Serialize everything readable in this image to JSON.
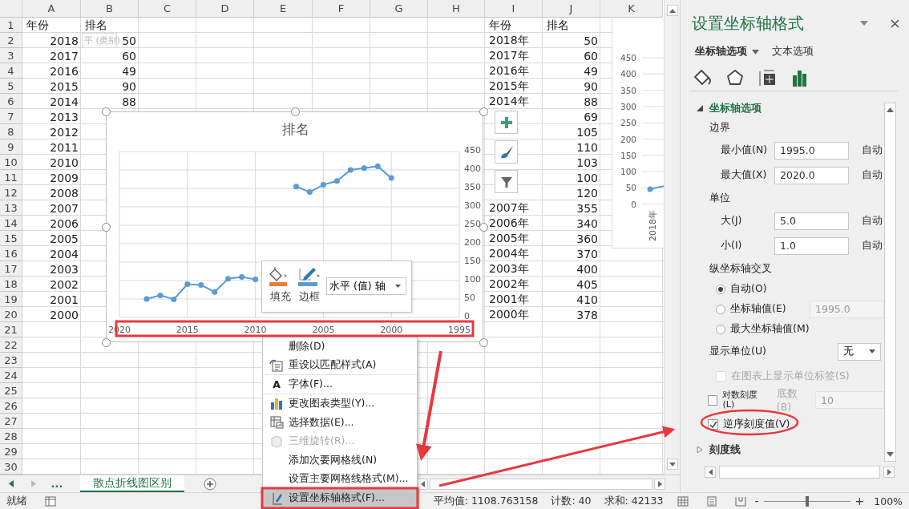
{
  "sheet": {
    "columns": [
      "A",
      "B",
      "C",
      "D",
      "E",
      "F",
      "G",
      "H",
      "I",
      "J",
      "K"
    ],
    "rows": [
      {
        "num": "1",
        "cells": {
          "A": {
            "text": "年份",
            "kind": "text"
          },
          "B": {
            "text": "排名",
            "kind": "text"
          },
          "I": {
            "text": "年份",
            "kind": "text"
          },
          "J": {
            "text": "排名",
            "kind": "text"
          }
        }
      },
      {
        "num": "2",
        "cells": {
          "A": {
            "text": "2018",
            "kind": "number"
          },
          "B": {
            "text": "50",
            "kind": "number"
          },
          "I": {
            "text": "2018年",
            "kind": "text"
          },
          "J": {
            "text": "50",
            "kind": "number"
          }
        }
      },
      {
        "num": "3",
        "cells": {
          "A": {
            "text": "2017",
            "kind": "number"
          },
          "B": {
            "text": "60",
            "kind": "number"
          },
          "I": {
            "text": "2017年",
            "kind": "text"
          },
          "J": {
            "text": "60",
            "kind": "number"
          }
        }
      },
      {
        "num": "4",
        "cells": {
          "A": {
            "text": "2016",
            "kind": "number"
          },
          "B": {
            "text": "49",
            "kind": "number"
          },
          "I": {
            "text": "2016年",
            "kind": "text"
          },
          "J": {
            "text": "49",
            "kind": "number"
          }
        }
      },
      {
        "num": "5",
        "cells": {
          "A": {
            "text": "2015",
            "kind": "number"
          },
          "B": {
            "text": "90",
            "kind": "number"
          },
          "I": {
            "text": "2015年",
            "kind": "text"
          },
          "J": {
            "text": "90",
            "kind": "number"
          }
        }
      },
      {
        "num": "6",
        "cells": {
          "A": {
            "text": "2014",
            "kind": "number"
          },
          "B": {
            "text": "88",
            "kind": "number"
          },
          "I": {
            "text": "2014年",
            "kind": "text"
          },
          "J": {
            "text": "88",
            "kind": "number"
          }
        }
      },
      {
        "num": "7",
        "cells": {
          "A": {
            "text": "2013",
            "kind": "number"
          },
          "J": {
            "text": "69",
            "kind": "number"
          }
        }
      },
      {
        "num": "8",
        "cells": {
          "A": {
            "text": "2012",
            "kind": "number"
          },
          "J": {
            "text": "105",
            "kind": "number"
          }
        }
      },
      {
        "num": "9",
        "cells": {
          "A": {
            "text": "2011",
            "kind": "number"
          },
          "J": {
            "text": "110",
            "kind": "number"
          }
        }
      },
      {
        "num": "10",
        "cells": {
          "A": {
            "text": "2010",
            "kind": "number"
          },
          "J": {
            "text": "103",
            "kind": "number"
          }
        }
      },
      {
        "num": "11",
        "cells": {
          "A": {
            "text": "2009",
            "kind": "number"
          },
          "J": {
            "text": "100",
            "kind": "number"
          }
        }
      },
      {
        "num": "12",
        "cells": {
          "A": {
            "text": "2008",
            "kind": "number"
          },
          "J": {
            "text": "120",
            "kind": "number"
          }
        }
      },
      {
        "num": "13",
        "cells": {
          "A": {
            "text": "2007",
            "kind": "number"
          },
          "I": {
            "text": "2007年",
            "kind": "text"
          },
          "J": {
            "text": "355",
            "kind": "number"
          }
        }
      },
      {
        "num": "14",
        "cells": {
          "A": {
            "text": "2006",
            "kind": "number"
          },
          "I": {
            "text": "2006年",
            "kind": "text"
          },
          "J": {
            "text": "340",
            "kind": "number"
          }
        }
      },
      {
        "num": "15",
        "cells": {
          "A": {
            "text": "2005",
            "kind": "number"
          },
          "I": {
            "text": "2005年",
            "kind": "text"
          },
          "J": {
            "text": "360",
            "kind": "number"
          }
        }
      },
      {
        "num": "16",
        "cells": {
          "A": {
            "text": "2004",
            "kind": "number"
          },
          "I": {
            "text": "2004年",
            "kind": "text"
          },
          "J": {
            "text": "370",
            "kind": "number"
          }
        }
      },
      {
        "num": "17",
        "cells": {
          "A": {
            "text": "2003",
            "kind": "number"
          },
          "I": {
            "text": "2003年",
            "kind": "text"
          },
          "J": {
            "text": "400",
            "kind": "number"
          }
        }
      },
      {
        "num": "18",
        "cells": {
          "A": {
            "text": "2002",
            "kind": "number"
          },
          "I": {
            "text": "2002年",
            "kind": "text"
          },
          "J": {
            "text": "405",
            "kind": "number"
          }
        }
      },
      {
        "num": "19",
        "cells": {
          "A": {
            "text": "2001",
            "kind": "number"
          },
          "I": {
            "text": "2001年",
            "kind": "text"
          },
          "J": {
            "text": "410",
            "kind": "number"
          }
        }
      },
      {
        "num": "20",
        "cells": {
          "A": {
            "text": "2000",
            "kind": "number"
          },
          "I": {
            "text": "2000年",
            "kind": "text"
          },
          "J": {
            "text": "378",
            "kind": "number"
          }
        }
      },
      {
        "num": "21"
      },
      {
        "num": "22"
      },
      {
        "num": "23"
      },
      {
        "num": "24"
      },
      {
        "num": "25"
      },
      {
        "num": "26"
      },
      {
        "num": "27"
      },
      {
        "num": "28"
      },
      {
        "num": "29"
      },
      {
        "num": "30"
      }
    ]
  },
  "tooltip": {
    "text": "平 (类别)"
  },
  "chart": {
    "chart_data": {
      "type": "line",
      "title": "排名",
      "x": [
        2018,
        2017,
        2016,
        2015,
        2014,
        2013,
        2012,
        2011,
        2010,
        2009,
        2008,
        2007,
        2006,
        2005,
        2004,
        2003,
        2002,
        2001,
        2000
      ],
      "series": [
        {
          "color": "#5b9bd5",
          "values": [
            50,
            60,
            49,
            90,
            88,
            69,
            105,
            110,
            103,
            null,
            null,
            355,
            340,
            360,
            370,
            400,
            405,
            410,
            378
          ]
        }
      ],
      "xlim": [
        2020,
        1995
      ],
      "ylim": [
        0,
        450
      ],
      "grid": true,
      "marker": true,
      "xticks": [
        {
          "value": 2020,
          "label": "2020"
        },
        {
          "value": 2015,
          "label": "2015"
        },
        {
          "value": 2010,
          "label": "2010"
        },
        {
          "value": 2005,
          "label": "2005"
        },
        {
          "value": 2000,
          "label": "2000"
        },
        {
          "value": 1995,
          "label": "1995"
        }
      ],
      "yticks": [
        {
          "value": 0,
          "label": "0"
        },
        {
          "value": 50,
          "label": "50"
        },
        {
          "value": 100,
          "label": "100"
        },
        {
          "value": 150,
          "label": "150"
        },
        {
          "value": 200,
          "label": "200"
        },
        {
          "value": 250,
          "label": "250"
        },
        {
          "value": 300,
          "label": "300"
        },
        {
          "value": 350,
          "label": "350"
        },
        {
          "value": 400,
          "label": "400"
        },
        {
          "value": 450,
          "label": "450"
        }
      ]
    }
  },
  "side_chart": {
    "tick_labels": [
      "450",
      "400",
      "350",
      "300",
      "250",
      "200",
      "150",
      "100",
      "50",
      "0"
    ],
    "category": "2018年"
  },
  "mini_toolbar": {
    "buttons": [
      {
        "kind": "fill",
        "label": "填充"
      },
      {
        "kind": "border",
        "label": "边框"
      }
    ],
    "dropdown": "水平 (值) 轴"
  },
  "context_menu": {
    "items": [
      {
        "kind": "plain",
        "label": "删除(D)",
        "selected": false,
        "disabled": false
      },
      {
        "kind": "reset",
        "label": "重设以匹配样式(A)",
        "selected": false,
        "disabled": false,
        "separator": true
      },
      {
        "kind": "font",
        "glyph": "A",
        "label": "字体(F)...",
        "selected": false,
        "disabled": false,
        "separator": true
      },
      {
        "kind": "chart",
        "label": "更改图表类型(Y)...",
        "selected": false,
        "disabled": false
      },
      {
        "kind": "data",
        "label": "选择数据(E)...",
        "selected": false,
        "disabled": false
      },
      {
        "kind": "rotate",
        "label": "三维旋转(R)...",
        "selected": false,
        "disabled": true
      },
      {
        "kind": "plain",
        "label": "添加次要网格线(N)",
        "selected": false,
        "disabled": false
      },
      {
        "kind": "plain",
        "label": "设置主要网格线格式(M)...",
        "selected": false,
        "disabled": false
      },
      {
        "kind": "format",
        "label": "设置坐标轴格式(F)...",
        "selected": true,
        "disabled": false
      }
    ]
  },
  "sheet_tabs": {
    "more": "...",
    "tabs": [
      {
        "label": "散点折线图区别",
        "selected": true
      }
    ]
  },
  "format_pane": {
    "title": "设置坐标轴格式",
    "tabs": [
      {
        "label": "坐标轴选项",
        "selected": true
      },
      {
        "label": "文本选项",
        "selected": false
      }
    ],
    "icon_tabs": [
      {
        "kind": "fill",
        "selected": false
      },
      {
        "kind": "effects",
        "selected": false
      },
      {
        "kind": "size",
        "selected": false
      },
      {
        "kind": "axis",
        "selected": true
      }
    ],
    "sections": [
      {
        "title": "坐标轴选项",
        "expanded": true,
        "rows": [
          {
            "kind": "heading",
            "label": "边界"
          },
          {
            "kind": "number",
            "label": "最小值(N)",
            "value": "1995.0",
            "auto": "自动"
          },
          {
            "kind": "number",
            "label": "最大值(X)",
            "value": "2020.0",
            "auto": "自动"
          },
          {
            "kind": "heading",
            "label": "单位"
          },
          {
            "kind": "number",
            "label": "大(J)",
            "value": "5.0",
            "auto": "自动"
          },
          {
            "kind": "number",
            "label": "小(I)",
            "value": "1.0",
            "auto": "自动"
          },
          {
            "kind": "heading",
            "label": "纵坐标轴交叉"
          },
          {
            "kind": "radio",
            "label": "自动(O)",
            "selected": true
          },
          {
            "kind": "radio",
            "label": "坐标轴值(E)",
            "selected": false,
            "value": "1995.0"
          },
          {
            "kind": "radio",
            "label": "最大坐标轴值(M)",
            "selected": false
          },
          {
            "kind": "select",
            "label": "显示单位(U)",
            "value": "无"
          },
          {
            "kind": "checkbox",
            "label": "在图表上显示单位标签(S)",
            "checked": false,
            "disabled": true
          },
          {
            "kind": "checkbox",
            "label": "对数刻度(L)",
            "checked": false,
            "disabled": false,
            "base_label": "底数(B)",
            "base_value": "10"
          },
          {
            "kind": "checkbox",
            "label": "逆序刻度值(V)",
            "checked": true,
            "disabled": false
          }
        ]
      },
      {
        "title": "刻度线",
        "expanded": false
      }
    ]
  },
  "status_bar": {
    "mode": "就绪",
    "average": "平均值: 1108.763158",
    "count": "计数: 40",
    "sum": "求和: 42133",
    "zoom_out": "-",
    "zoom_in": "+",
    "zoom": "100%",
    "level": 0.5
  }
}
